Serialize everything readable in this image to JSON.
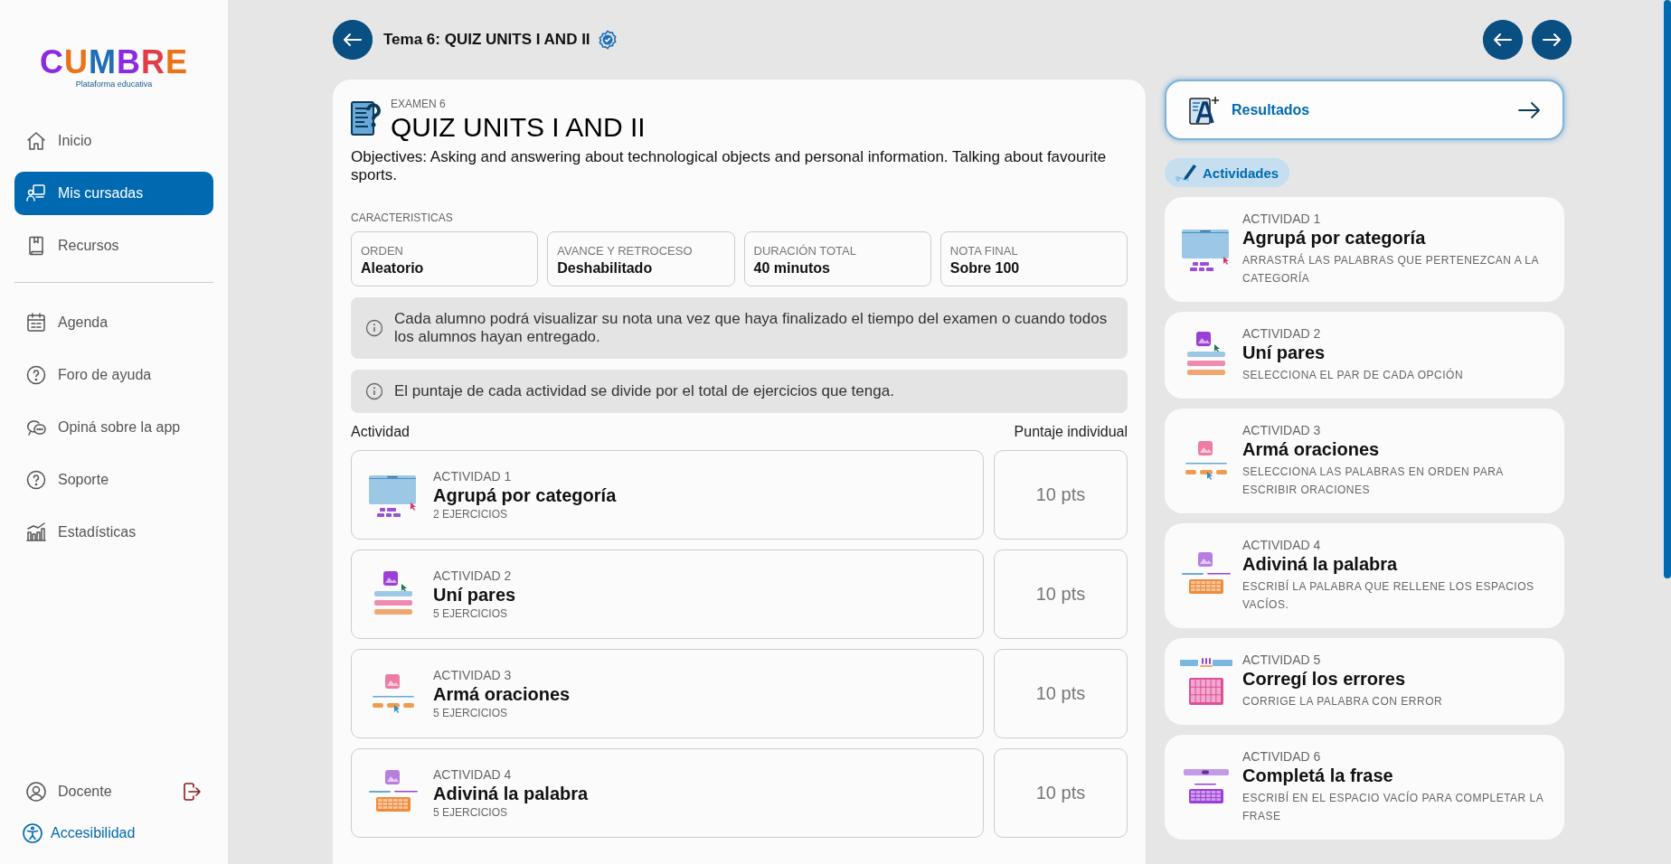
{
  "sidebar": {
    "logo": "CUMBRE",
    "tagline": "Plataforma educativa",
    "items": [
      {
        "kind": "home",
        "label": "Inicio",
        "selected": false
      },
      {
        "kind": "courses",
        "label": "Mis cursadas",
        "selected": true
      },
      {
        "kind": "book",
        "label": "Recursos",
        "selected": false
      },
      {
        "kind": "calendar",
        "label": "Agenda",
        "selected": false
      },
      {
        "kind": "help",
        "label": "Foro de ayuda",
        "selected": false
      },
      {
        "kind": "chat",
        "label": "Opiná sobre la app",
        "selected": false
      },
      {
        "kind": "help",
        "label": "Soporte",
        "selected": false
      },
      {
        "kind": "stats",
        "label": "Estadísticas",
        "selected": false
      }
    ],
    "user": "Docente",
    "accessibility": "Accesibilidad"
  },
  "header": {
    "title": "Tema 6: QUIZ UNITS I AND II",
    "verified": true
  },
  "exam": {
    "eyebrow": "EXAMEN 6",
    "title": "QUIZ UNITS I AND II",
    "objectives": "Objectives: Asking and answering about technological objects and personal information. Talking about favourite sports.",
    "features_label": "CARACTERISTICAS",
    "features": [
      {
        "label": "ORDEN",
        "value": "Aleatorio"
      },
      {
        "label": "AVANCE Y RETROCESO",
        "value": "Deshabilitado"
      },
      {
        "label": "DURACIÓN TOTAL",
        "value": "40 minutos"
      },
      {
        "label": "NOTA FINAL",
        "value": "Sobre 100"
      }
    ],
    "notes": [
      "Cada alumno podrá visualizar su nota una vez que haya finalizado el tiempo del examen o cuando todos los alumnos hayan entregado.",
      "El puntaje de cada actividad se divide por el total de ejercicios que tenga."
    ],
    "columns": [
      "Actividad",
      "Puntaje individual"
    ],
    "activities": [
      {
        "kind": "categorize",
        "number": "ACTIVIDAD 1",
        "name": "Agrupá por categoría",
        "exercises": "2 EJERCICIOS",
        "score": "10 pts"
      },
      {
        "kind": "pairs",
        "number": "ACTIVIDAD 2",
        "name": "Uní pares",
        "exercises": "5 EJERCICIOS",
        "score": "10 pts"
      },
      {
        "kind": "sentences",
        "number": "ACTIVIDAD 3",
        "name": "Armá oraciones",
        "exercises": "5 EJERCICIOS",
        "score": "10 pts"
      },
      {
        "kind": "guess",
        "number": "ACTIVIDAD 4",
        "name": "Adiviná la palabra",
        "exercises": "5 EJERCICIOS",
        "score": "10 pts"
      }
    ]
  },
  "results": {
    "label": "Resultados"
  },
  "activities_tag": "Actividades",
  "activity_cards": [
    {
      "kind": "categorize",
      "number": "ACTIVIDAD 1",
      "name": "Agrupá por categoría",
      "instruction": "ARRASTRÁ LAS PALABRAS QUE PERTENEZCAN A LA CATEGORÍA"
    },
    {
      "kind": "pairs",
      "number": "ACTIVIDAD 2",
      "name": "Uní pares",
      "instruction": "SELECCIONA EL PAR DE CADA OPCIÓN"
    },
    {
      "kind": "sentences",
      "number": "ACTIVIDAD 3",
      "name": "Armá oraciones",
      "instruction": "SELECCIONA LAS PALABRAS EN ORDEN PARA ESCRIBIR ORACIONES"
    },
    {
      "kind": "guess",
      "number": "ACTIVIDAD 4",
      "name": "Adiviná la palabra",
      "instruction": "ESCRIBÍ LA PALABRA QUE RELLENE LOS ESPACIOS VACÍOS."
    },
    {
      "kind": "correct",
      "number": "ACTIVIDAD 5",
      "name": "Corregí los errores",
      "instruction": "CORRIGE LA PALABRA CON ERROR"
    },
    {
      "kind": "complete",
      "number": "ACTIVIDAD 6",
      "name": "Completá la frase",
      "instruction": "ESCRIBÍ EN EL ESPACIO VACÍO PARA COMPLETAR LA FRASE"
    }
  ]
}
